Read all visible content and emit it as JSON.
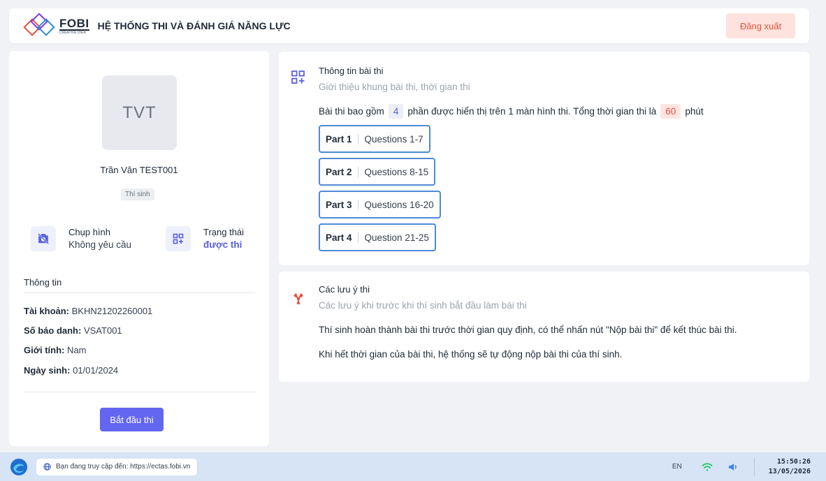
{
  "header": {
    "logo_text": "FOBI",
    "logo_subtext": "CREATIVE IDEA",
    "title": "HỆ THỐNG THI VÀ ĐÁNH GIÁ NĂNG LỰC",
    "logout_label": "Đăng xuất"
  },
  "profile": {
    "initials": "TVT",
    "name": "Trần Văn TEST001",
    "role": "Thí sinh",
    "photo_label": "Chụp hình",
    "photo_value": "Không yêu cầu",
    "status_label": "Trạng thái",
    "status_value": "được thi",
    "info_title": "Thông tin",
    "account_label": "Tài khoản:",
    "account_value": "BKHN21202260001",
    "candidate_no_label": "Số báo danh:",
    "candidate_no_value": "VSAT001",
    "gender_label": "Giới tính:",
    "gender_value": "Nam",
    "dob_label": "Ngày sinh:",
    "dob_value": "01/01/2024",
    "start_label": "Bắt đầu thi"
  },
  "exam_info": {
    "title": "Thông tin bài thi",
    "subtitle": "Giới thiệu khung bài thi, thời gian thi",
    "summary_prefix": "Bài thi bao gồm",
    "part_count": "4",
    "summary_middle": "phần được hiển thị trên 1 màn hình thi. Tổng thời gian thi là",
    "duration": "60",
    "summary_suffix": "phút",
    "parts": [
      {
        "name": "Part 1",
        "questions": "Questions 1-7"
      },
      {
        "name": "Part 2",
        "questions": "Questions 8-15"
      },
      {
        "name": "Part 3",
        "questions": "Questions 16-20"
      },
      {
        "name": "Part 4",
        "questions": "Question 21-25"
      }
    ]
  },
  "notes": {
    "title": "Các lưu ý thi",
    "subtitle": "Các lưu ý khi trước khi thí sinh bắt đầu làm bài thi",
    "items": [
      "Thí sinh hoàn thành bài thi trước thời gian quy định, có thể nhấn nút \"Nộp bài thi\" để kết thúc bài thi.",
      "Khi hết thời gian của bài thi, hệ thống sẽ tự động nộp bài thi của thí sinh."
    ]
  },
  "taskbar": {
    "url_text": "Bạn đang truy cập đến: https://ectas.fobi.vn",
    "language": "EN",
    "time": "15:50:26",
    "date": "13/05/2026"
  },
  "colors": {
    "accent": "#6366f1",
    "danger": "#e5533d",
    "part_border": "#4f8ad6",
    "background": "#f0f2f5"
  }
}
